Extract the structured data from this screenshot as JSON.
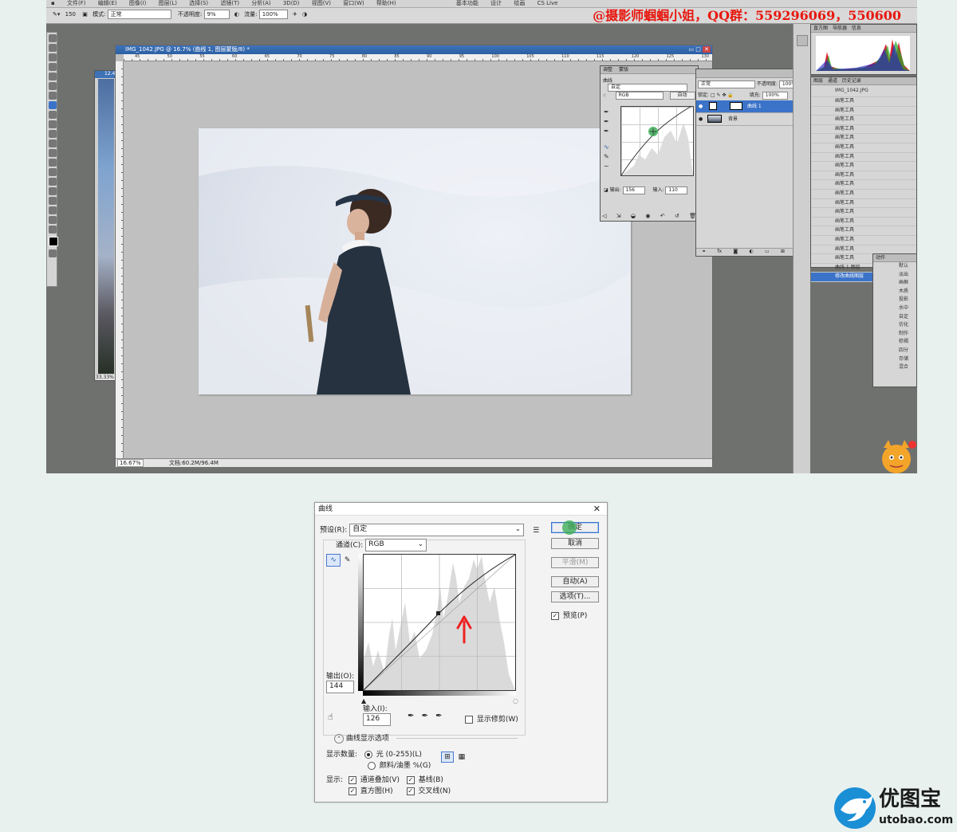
{
  "menubar": {
    "items": [
      "文件(F)",
      "编辑(E)",
      "图像(I)",
      "图层(L)",
      "选择(S)",
      "滤镜(T)",
      "分析(A)",
      "3D(D)",
      "视图(V)",
      "窗口(W)",
      "帮助(H)"
    ],
    "workspace_items": [
      "基本功能",
      "设计",
      "绘画"
    ],
    "cs_live": "CS Live"
  },
  "optionsbar": {
    "brush_size": "150",
    "mode_label": "模式:",
    "mode_value": "正常",
    "opacity_label": "不透明度:",
    "opacity_value": "9%",
    "flow_label": "流量:",
    "flow_value": "100%"
  },
  "watermark": "@摄影师蝈蝈小姐，QQ群：559296069，550600",
  "thin_document": {
    "title": "12.4",
    "zoom": "33.33%"
  },
  "document": {
    "title": "IMG_1042.JPG @ 16.7% (曲线 1, 图层蒙版/8) *",
    "ruler_ticks": [
      "45",
      "50",
      "55",
      "60",
      "65",
      "70",
      "75",
      "80",
      "85",
      "90",
      "95",
      "100",
      "105",
      "110",
      "115",
      "120",
      "125",
      "130"
    ],
    "zoom": "16.67%",
    "file_info": "文档:60.2M/96.4M"
  },
  "adjustments_panel": {
    "tabs": [
      "调整",
      "蒙版"
    ],
    "title": "曲线",
    "preset": "自定",
    "channel": "RGB",
    "auto_label": "自动",
    "output_label": "输出:",
    "output_value": "156",
    "input_label": "输入:",
    "input_value": "110"
  },
  "layers_panel": {
    "blend_mode": "正常",
    "opacity_label": "不透明度:",
    "opacity_value": "100%",
    "lock_label": "锁定:",
    "fill_label": "填充:",
    "fill_value": "100%",
    "layers": [
      {
        "name": "曲线 1",
        "selected": true
      },
      {
        "name": "背景",
        "selected": false
      }
    ]
  },
  "history_panel": {
    "tabs": [
      "图层",
      "通道",
      "历史记录"
    ],
    "snapshot": "IMG_1042.JPG",
    "entries": [
      "画笔工具",
      "画笔工具",
      "画笔工具",
      "画笔工具",
      "画笔工具",
      "画笔工具",
      "画笔工具",
      "画笔工具",
      "画笔工具",
      "画笔工具",
      "画笔工具",
      "画笔工具",
      "画笔工具",
      "画笔工具",
      "画笔工具",
      "画笔工具",
      "画笔工具",
      "画笔工具"
    ],
    "last_entry": "曲线 1 图层",
    "current_entry": "修改曲线图层"
  },
  "navigator_panel": {
    "tabs": [
      "直方图",
      "导航器",
      "信息"
    ]
  },
  "actions_panel": {
    "tab": "动作",
    "items": [
      "默认",
      "淡出",
      "画框",
      "木质",
      "投影",
      "水中",
      "自定",
      "仿化",
      "制作",
      "棕褐",
      "四分",
      "存储",
      "混合"
    ]
  },
  "curves_dialog": {
    "title": "曲线",
    "preset_label": "预设(R):",
    "preset_value": "自定",
    "channel_label": "通道(C):",
    "channel_value": "RGB",
    "ok_label": "确定",
    "cancel_label": "取消",
    "smooth_label": "平滑(M)",
    "auto_label": "自动(A)",
    "options_label": "选项(T)...",
    "preview_label": "预览(P)",
    "output_label": "输出(O):",
    "output_value": "144",
    "input_label": "输入(I):",
    "input_value": "126",
    "show_clipping_label": "显示修剪(W)",
    "display_options_label": "曲线显示选项",
    "show_amount_label": "显示数量:",
    "light_label": "光 (0-255)(L)",
    "pigment_label": "颜料/油墨 %(G)",
    "show_label": "显示:",
    "channel_overlays_label": "通道叠加(V)",
    "baseline_label": "基线(B)",
    "histogram_label": "直方图(H)",
    "intersection_label": "交叉线(N)"
  },
  "logo": {
    "name": "优图宝",
    "url": "utobao.com"
  },
  "colors": {
    "accent_red": "#e8170e",
    "title_blue": "#2b5fa4",
    "marker_green": "#3fae5a",
    "logo_blue": "#1a8fd6"
  }
}
